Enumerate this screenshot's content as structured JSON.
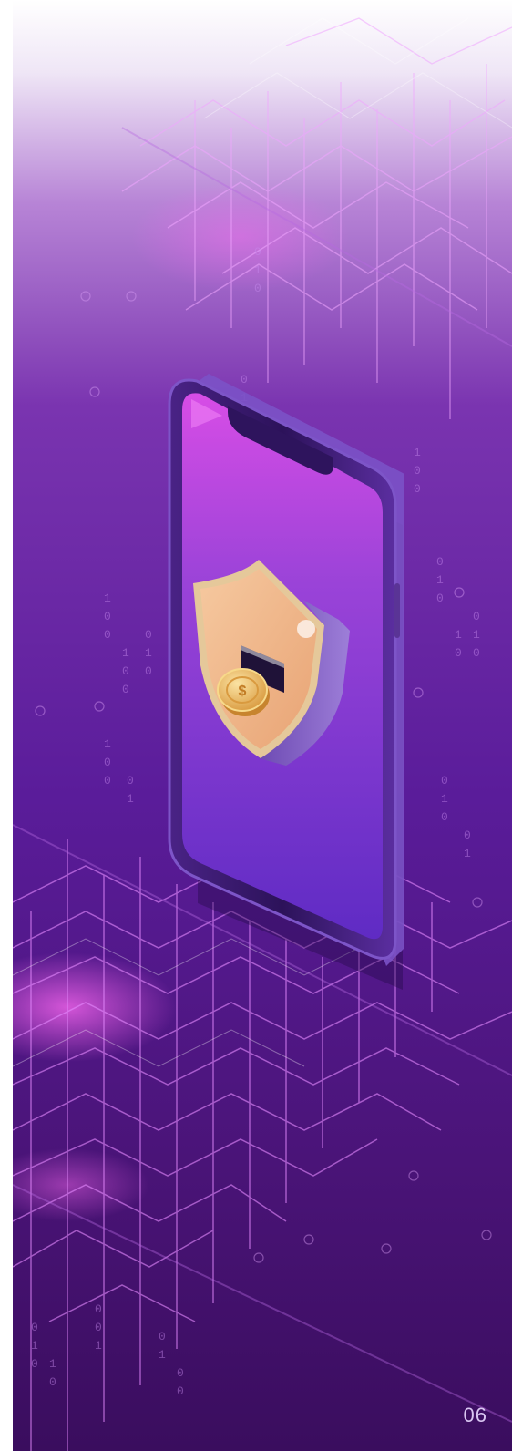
{
  "page": {
    "number": "06"
  },
  "illustration": {
    "subject": "smartphone-security-shield",
    "icons": [
      "smartphone-icon",
      "shield-icon",
      "coin-icon",
      "circuit-lines"
    ],
    "colors": {
      "background_top": "#ffffff",
      "background_mid": "#5a1c9a",
      "background_bottom": "#3a0d5e",
      "circuit": "#e58aff",
      "shield": "#f1b98c",
      "coin": "#f2c36b",
      "phone_frame": "#3b1a70"
    }
  }
}
